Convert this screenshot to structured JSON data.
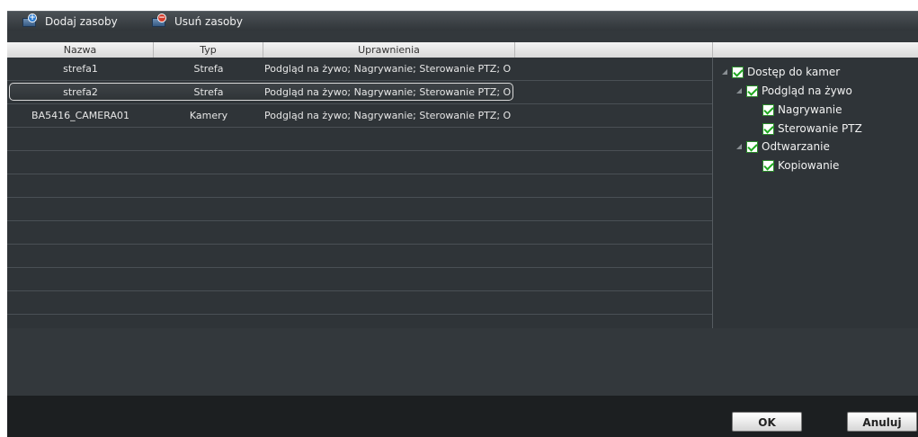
{
  "toolbar": {
    "add_label": "Dodaj zasoby",
    "remove_label": "Usuń zasoby",
    "add_icon": "add-resource-icon",
    "remove_icon": "remove-resource-icon"
  },
  "table": {
    "headers": [
      "Nazwa",
      "Typ",
      "Uprawnienia"
    ],
    "rows": [
      {
        "name": "strefa1",
        "type": "Strefa",
        "perm": "Podgląd na żywo; Nagrywanie; Sterowanie PTZ; O"
      },
      {
        "name": "strefa2",
        "type": "Strefa",
        "perm": "Podgląd na żywo; Nagrywanie; Sterowanie PTZ; O"
      },
      {
        "name": "BA5416_CAMERA01",
        "type": "Kamery",
        "perm": "Podgląd na żywo; Nagrywanie; Sterowanie PTZ; O"
      }
    ],
    "selected_row": 1
  },
  "tree": {
    "root": "Dostęp do kamer",
    "live": "Podgląd na żywo",
    "record": "Nagrywanie",
    "ptz": "Sterowanie PTZ",
    "playback": "Odtwarzanie",
    "copy": "Kopiowanie"
  },
  "buttons": {
    "ok": "OK",
    "cancel": "Anuluj"
  },
  "colors": {
    "panel_bg": "#2f3438",
    "check_green": "#1fa81f"
  }
}
